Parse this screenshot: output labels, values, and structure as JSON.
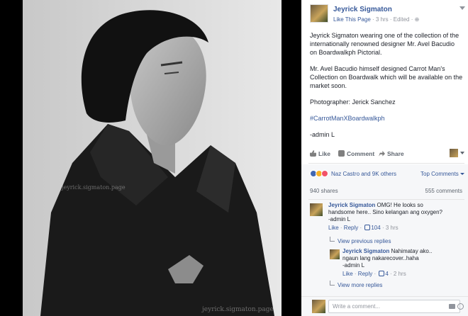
{
  "photo": {
    "watermark_1": "jeyrick.sigmaton.page",
    "watermark_2": "jeyrick.sigmaton.page"
  },
  "header": {
    "page_name": "Jeyrick Sigmaton",
    "like_label": "Like This Page",
    "meta": " · 3 hrs · Edited · "
  },
  "post": {
    "para1": "Jeyrick Sigmaton wearing one of the collection of the internationally renowned designer Mr. Avel Bacudio on Boardwalkph Pictorial.",
    "para2": "Mr. Avel Bacudio himself designed Carrot Man's Collection on Boardwalk which will be available on the market soon.",
    "para3": "Photographer: Jerick Sanchez",
    "hashtag": "#CarrotManXBoardwalkph",
    "signoff": "-admin L"
  },
  "actions": {
    "like": "Like",
    "comment": "Comment",
    "share": "Share"
  },
  "reactions": {
    "summary": "Naz Castro and 9K others",
    "top_comments": "Top Comments"
  },
  "counts": {
    "shares": "940 shares",
    "comments": "555 comments"
  },
  "comments": [
    {
      "author": "Jeyrick Sigmaton",
      "text": "OMG! He looks so handsome here.. Sino kelangan ang oxygen?",
      "signoff": "-admin L",
      "like": "Like",
      "reply": "Reply",
      "likes": "104",
      "time": "3 hrs"
    },
    {
      "author": "Jeyrick Sigmaton",
      "text": "Nahimatay ako.. ngaun lang nakarecover..haha",
      "signoff": "-admin L",
      "like": "Like",
      "reply": "Reply",
      "likes": "4",
      "time": "2 hrs"
    }
  ],
  "links": {
    "view_previous": "View previous replies",
    "view_more": "View more replies"
  },
  "composer": {
    "placeholder": "Write a comment..."
  }
}
